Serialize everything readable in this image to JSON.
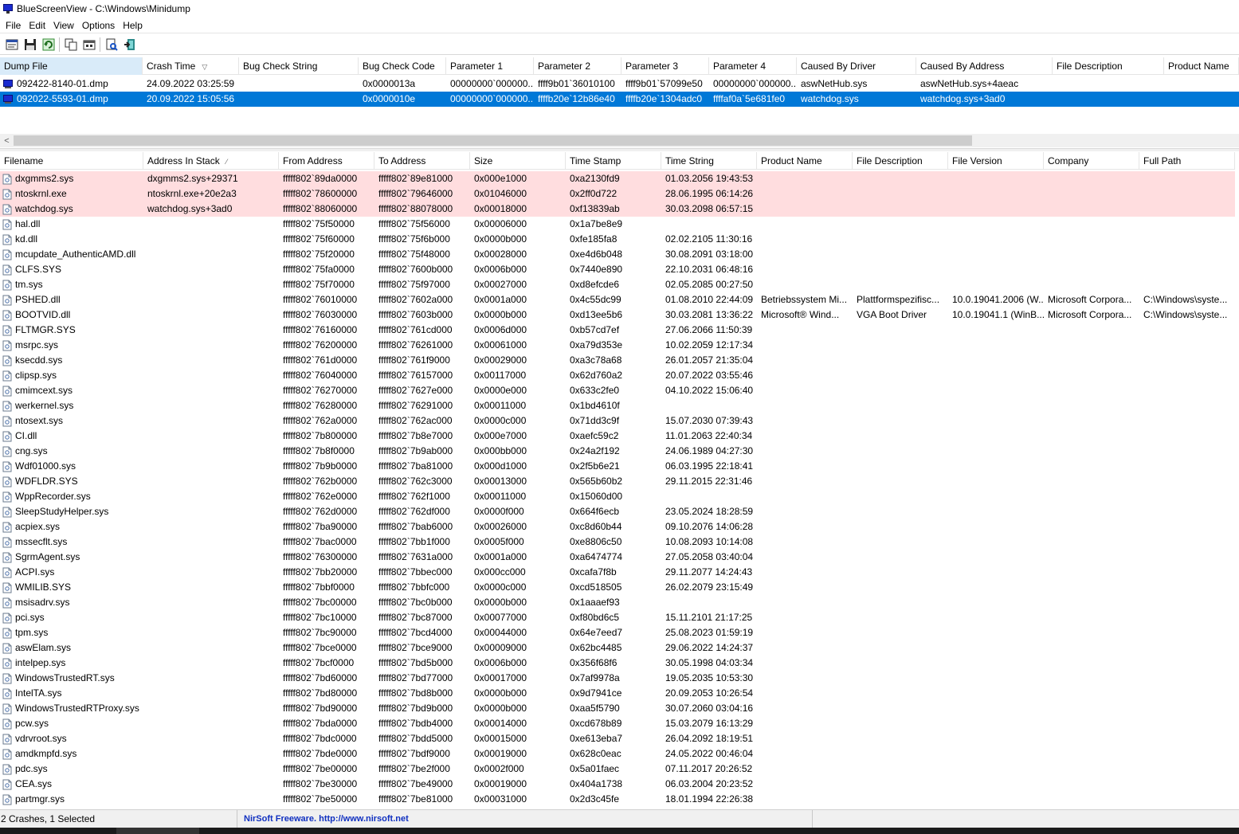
{
  "window": {
    "title": "BlueScreenView  -  C:\\Windows\\Minidump"
  },
  "menu": [
    "File",
    "Edit",
    "View",
    "Options",
    "Help"
  ],
  "toolbar": [
    "properties-icon",
    "save-icon",
    "refresh-icon",
    "copy-icon",
    "html-report-icon",
    "find-icon",
    "exit-icon"
  ],
  "top_table": {
    "columns": [
      {
        "label": "Dump File",
        "w": 179
      },
      {
        "label": "Crash Time",
        "w": 121,
        "sort": "▽"
      },
      {
        "label": "Bug Check String",
        "w": 150
      },
      {
        "label": "Bug Check Code",
        "w": 110
      },
      {
        "label": "Parameter 1",
        "w": 110
      },
      {
        "label": "Parameter 2",
        "w": 110
      },
      {
        "label": "Parameter 3",
        "w": 110
      },
      {
        "label": "Parameter 4",
        "w": 110
      },
      {
        "label": "Caused By Driver",
        "w": 150
      },
      {
        "label": "Caused By Address",
        "w": 171
      },
      {
        "label": "File Description",
        "w": 140
      },
      {
        "label": "Product Name",
        "w": 94
      }
    ],
    "rows": [
      [
        "092422-8140-01.dmp",
        "24.09.2022 03:25:59",
        "",
        "0x0000013a",
        "00000000`000000...",
        "ffff9b01`36010100",
        "ffff9b01`57099e50",
        "00000000`000000...",
        "aswNetHub.sys",
        "aswNetHub.sys+4aeac",
        "",
        ""
      ],
      [
        "092022-5593-01.dmp",
        "20.09.2022 15:05:56",
        "",
        "0x0000010e",
        "00000000`000000...",
        "ffffb20e`12b86e40",
        "ffffb20e`1304adc0",
        "ffffaf0a`5e681fe0",
        "watchdog.sys",
        "watchdog.sys+3ad0",
        "",
        ""
      ]
    ],
    "selected_index": 1
  },
  "bottom_table": {
    "columns": [
      {
        "label": "Filename",
        "w": 180
      },
      {
        "label": "Address In Stack",
        "w": 170,
        "sort": "⁄"
      },
      {
        "label": "From Address",
        "w": 120
      },
      {
        "label": "To Address",
        "w": 120
      },
      {
        "label": "Size",
        "w": 120
      },
      {
        "label": "Time Stamp",
        "w": 120
      },
      {
        "label": "Time String",
        "w": 120
      },
      {
        "label": "Product Name",
        "w": 120
      },
      {
        "label": "File Description",
        "w": 120
      },
      {
        "label": "File Version",
        "w": 120
      },
      {
        "label": "Company",
        "w": 120
      },
      {
        "label": "Full Path",
        "w": 120
      }
    ],
    "rows": [
      [
        "dxgmms2.sys",
        "dxgmms2.sys+29371",
        "fffff802`89da0000",
        "fffff802`89e81000",
        "0x000e1000",
        "0xa2130fd9",
        "01.03.2056 19:43:53",
        "",
        "",
        "",
        "",
        ""
      ],
      [
        "ntoskrnl.exe",
        "ntoskrnl.exe+20e2a3",
        "fffff802`78600000",
        "fffff802`79646000",
        "0x01046000",
        "0x2ff0d722",
        "28.06.1995 06:14:26",
        "",
        "",
        "",
        "",
        ""
      ],
      [
        "watchdog.sys",
        "watchdog.sys+3ad0",
        "fffff802`88060000",
        "fffff802`88078000",
        "0x00018000",
        "0xf13839ab",
        "30.03.2098 06:57:15",
        "",
        "",
        "",
        "",
        ""
      ],
      [
        "hal.dll",
        "",
        "fffff802`75f50000",
        "fffff802`75f56000",
        "0x00006000",
        "0x1a7be8e9",
        "",
        "",
        "",
        "",
        "",
        ""
      ],
      [
        "kd.dll",
        "",
        "fffff802`75f60000",
        "fffff802`75f6b000",
        "0x0000b000",
        "0xfe185fa8",
        "02.02.2105 11:30:16",
        "",
        "",
        "",
        "",
        ""
      ],
      [
        "mcupdate_AuthenticAMD.dll",
        "",
        "fffff802`75f20000",
        "fffff802`75f48000",
        "0x00028000",
        "0xe4d6b048",
        "30.08.2091 03:18:00",
        "",
        "",
        "",
        "",
        ""
      ],
      [
        "CLFS.SYS",
        "",
        "fffff802`75fa0000",
        "fffff802`7600b000",
        "0x0006b000",
        "0x7440e890",
        "22.10.2031 06:48:16",
        "",
        "",
        "",
        "",
        ""
      ],
      [
        "tm.sys",
        "",
        "fffff802`75f70000",
        "fffff802`75f97000",
        "0x00027000",
        "0xd8efcde6",
        "02.05.2085 00:27:50",
        "",
        "",
        "",
        "",
        ""
      ],
      [
        "PSHED.dll",
        "",
        "fffff802`76010000",
        "fffff802`7602a000",
        "0x0001a000",
        "0x4c55dc99",
        "01.08.2010 22:44:09",
        "Betriebssystem Mi...",
        "Plattformspezifisc...",
        "10.0.19041.2006 (W...",
        "Microsoft Corpora...",
        "C:\\Windows\\syste..."
      ],
      [
        "BOOTVID.dll",
        "",
        "fffff802`76030000",
        "fffff802`7603b000",
        "0x0000b000",
        "0xd13ee5b6",
        "30.03.2081 13:36:22",
        "Microsoft® Wind...",
        "VGA Boot Driver",
        "10.0.19041.1 (WinB...",
        "Microsoft Corpora...",
        "C:\\Windows\\syste..."
      ],
      [
        "FLTMGR.SYS",
        "",
        "fffff802`76160000",
        "fffff802`761cd000",
        "0x0006d000",
        "0xb57cd7ef",
        "27.06.2066 11:50:39",
        "",
        "",
        "",
        "",
        ""
      ],
      [
        "msrpc.sys",
        "",
        "fffff802`76200000",
        "fffff802`76261000",
        "0x00061000",
        "0xa79d353e",
        "10.02.2059 12:17:34",
        "",
        "",
        "",
        "",
        ""
      ],
      [
        "ksecdd.sys",
        "",
        "fffff802`761d0000",
        "fffff802`761f9000",
        "0x00029000",
        "0xa3c78a68",
        "26.01.2057 21:35:04",
        "",
        "",
        "",
        "",
        ""
      ],
      [
        "clipsp.sys",
        "",
        "fffff802`76040000",
        "fffff802`76157000",
        "0x00117000",
        "0x62d760a2",
        "20.07.2022 03:55:46",
        "",
        "",
        "",
        "",
        ""
      ],
      [
        "cmimcext.sys",
        "",
        "fffff802`76270000",
        "fffff802`7627e000",
        "0x0000e000",
        "0x633c2fe0",
        "04.10.2022 15:06:40",
        "",
        "",
        "",
        "",
        ""
      ],
      [
        "werkernel.sys",
        "",
        "fffff802`76280000",
        "fffff802`76291000",
        "0x00011000",
        "0x1bd4610f",
        "",
        "",
        "",
        "",
        "",
        ""
      ],
      [
        "ntosext.sys",
        "",
        "fffff802`762a0000",
        "fffff802`762ac000",
        "0x0000c000",
        "0x71dd3c9f",
        "15.07.2030 07:39:43",
        "",
        "",
        "",
        "",
        ""
      ],
      [
        "CI.dll",
        "",
        "fffff802`7b800000",
        "fffff802`7b8e7000",
        "0x000e7000",
        "0xaefc59c2",
        "11.01.2063 22:40:34",
        "",
        "",
        "",
        "",
        ""
      ],
      [
        "cng.sys",
        "",
        "fffff802`7b8f0000",
        "fffff802`7b9ab000",
        "0x000bb000",
        "0x24a2f192",
        "24.06.1989 04:27:30",
        "",
        "",
        "",
        "",
        ""
      ],
      [
        "Wdf01000.sys",
        "",
        "fffff802`7b9b0000",
        "fffff802`7ba81000",
        "0x000d1000",
        "0x2f5b6e21",
        "06.03.1995 22:18:41",
        "",
        "",
        "",
        "",
        ""
      ],
      [
        "WDFLDR.SYS",
        "",
        "fffff802`762b0000",
        "fffff802`762c3000",
        "0x00013000",
        "0x565b60b2",
        "29.11.2015 22:31:46",
        "",
        "",
        "",
        "",
        ""
      ],
      [
        "WppRecorder.sys",
        "",
        "fffff802`762e0000",
        "fffff802`762f1000",
        "0x00011000",
        "0x15060d00",
        "",
        "",
        "",
        "",
        "",
        ""
      ],
      [
        "SleepStudyHelper.sys",
        "",
        "fffff802`762d0000",
        "fffff802`762df000",
        "0x0000f000",
        "0x664f6ecb",
        "23.05.2024 18:28:59",
        "",
        "",
        "",
        "",
        ""
      ],
      [
        "acpiex.sys",
        "",
        "fffff802`7ba90000",
        "fffff802`7bab6000",
        "0x00026000",
        "0xc8d60b44",
        "09.10.2076 14:06:28",
        "",
        "",
        "",
        "",
        ""
      ],
      [
        "mssecflt.sys",
        "",
        "fffff802`7bac0000",
        "fffff802`7bb1f000",
        "0x0005f000",
        "0xe8806c50",
        "10.08.2093 10:14:08",
        "",
        "",
        "",
        "",
        ""
      ],
      [
        "SgrmAgent.sys",
        "",
        "fffff802`76300000",
        "fffff802`7631a000",
        "0x0001a000",
        "0xa6474774",
        "27.05.2058 03:40:04",
        "",
        "",
        "",
        "",
        ""
      ],
      [
        "ACPI.sys",
        "",
        "fffff802`7bb20000",
        "fffff802`7bbec000",
        "0x000cc000",
        "0xcafa7f8b",
        "29.11.2077 14:24:43",
        "",
        "",
        "",
        "",
        ""
      ],
      [
        "WMILIB.SYS",
        "",
        "fffff802`7bbf0000",
        "fffff802`7bbfc000",
        "0x0000c000",
        "0xcd518505",
        "26.02.2079 23:15:49",
        "",
        "",
        "",
        "",
        ""
      ],
      [
        "msisadrv.sys",
        "",
        "fffff802`7bc00000",
        "fffff802`7bc0b000",
        "0x0000b000",
        "0x1aaaef93",
        "",
        "",
        "",
        "",
        "",
        ""
      ],
      [
        "pci.sys",
        "",
        "fffff802`7bc10000",
        "fffff802`7bc87000",
        "0x00077000",
        "0xf80bd6c5",
        "15.11.2101 21:17:25",
        "",
        "",
        "",
        "",
        ""
      ],
      [
        "tpm.sys",
        "",
        "fffff802`7bc90000",
        "fffff802`7bcd4000",
        "0x00044000",
        "0x64e7eed7",
        "25.08.2023 01:59:19",
        "",
        "",
        "",
        "",
        ""
      ],
      [
        "aswElam.sys",
        "",
        "fffff802`7bce0000",
        "fffff802`7bce9000",
        "0x00009000",
        "0x62bc4485",
        "29.06.2022 14:24:37",
        "",
        "",
        "",
        "",
        ""
      ],
      [
        "intelpep.sys",
        "",
        "fffff802`7bcf0000",
        "fffff802`7bd5b000",
        "0x0006b000",
        "0x356f68f6",
        "30.05.1998 04:03:34",
        "",
        "",
        "",
        "",
        ""
      ],
      [
        "WindowsTrustedRT.sys",
        "",
        "fffff802`7bd60000",
        "fffff802`7bd77000",
        "0x00017000",
        "0x7af9978a",
        "19.05.2035 10:53:30",
        "",
        "",
        "",
        "",
        ""
      ],
      [
        "IntelTA.sys",
        "",
        "fffff802`7bd80000",
        "fffff802`7bd8b000",
        "0x0000b000",
        "0x9d7941ce",
        "20.09.2053 10:26:54",
        "",
        "",
        "",
        "",
        ""
      ],
      [
        "WindowsTrustedRTProxy.sys",
        "",
        "fffff802`7bd90000",
        "fffff802`7bd9b000",
        "0x0000b000",
        "0xaa5f5790",
        "30.07.2060 03:04:16",
        "",
        "",
        "",
        "",
        ""
      ],
      [
        "pcw.sys",
        "",
        "fffff802`7bda0000",
        "fffff802`7bdb4000",
        "0x00014000",
        "0xcd678b89",
        "15.03.2079 16:13:29",
        "",
        "",
        "",
        "",
        ""
      ],
      [
        "vdrvroot.sys",
        "",
        "fffff802`7bdc0000",
        "fffff802`7bdd5000",
        "0x00015000",
        "0xe613eba7",
        "26.04.2092 18:19:51",
        "",
        "",
        "",
        "",
        ""
      ],
      [
        "amdkmpfd.sys",
        "",
        "fffff802`7bde0000",
        "fffff802`7bdf9000",
        "0x00019000",
        "0x628c0eac",
        "24.05.2022 00:46:04",
        "",
        "",
        "",
        "",
        ""
      ],
      [
        "pdc.sys",
        "",
        "fffff802`7be00000",
        "fffff802`7be2f000",
        "0x0002f000",
        "0x5a01faec",
        "07.11.2017 20:26:52",
        "",
        "",
        "",
        "",
        ""
      ],
      [
        "CEA.sys",
        "",
        "fffff802`7be30000",
        "fffff802`7be49000",
        "0x00019000",
        "0x404a1738",
        "06.03.2004 20:23:52",
        "",
        "",
        "",
        "",
        ""
      ],
      [
        "partmgr.sys",
        "",
        "fffff802`7be50000",
        "fffff802`7be81000",
        "0x00031000",
        "0x2d3c45fe",
        "18.01.1994 22:26:38",
        "",
        "",
        "",
        "",
        ""
      ]
    ],
    "highlight_count": 3
  },
  "status": {
    "left": "2 Crashes, 1 Selected",
    "center": "NirSoft Freeware.  http://www.nirsoft.net"
  },
  "scrollbar": {
    "left_arrow": "<"
  },
  "colors": {
    "selection": "#0078d7",
    "highlight": "#ffdddf",
    "link": "#1030c0"
  }
}
